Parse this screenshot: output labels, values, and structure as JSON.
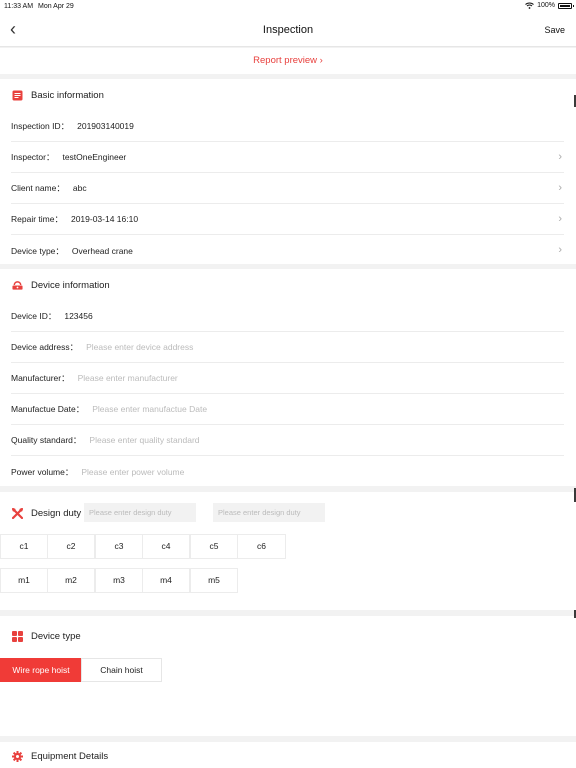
{
  "status": {
    "time": "11:33 AM",
    "date": "Mon Apr 29",
    "battery": "100%"
  },
  "nav": {
    "title": "Inspection",
    "save_label": "Save"
  },
  "report_preview": "Report preview ›",
  "basic": {
    "title": "Basic information",
    "rows": [
      {
        "label": "Inspection ID：",
        "value": "201903140019",
        "chevron": false
      },
      {
        "label": "Inspector：",
        "value": "testOneEngineer",
        "chevron": true
      },
      {
        "label": "Client name：",
        "value": "abc",
        "chevron": true
      },
      {
        "label": "Repair time：",
        "value": "2019-03-14 16:10",
        "chevron": true
      },
      {
        "label": "Device type：",
        "value": "Overhead crane",
        "chevron": true
      }
    ]
  },
  "device": {
    "title": "Device information",
    "rows": [
      {
        "label": "Device ID：",
        "value": "123456"
      },
      {
        "label": "Device address：",
        "placeholder": "Please enter device address"
      },
      {
        "label": "Manufacturer：",
        "placeholder": "Please enter manufacturer"
      },
      {
        "label": "Manufactue Date：",
        "placeholder": "Please enter manufactue Date"
      },
      {
        "label": "Quality standard：",
        "placeholder": "Please enter quality standard"
      },
      {
        "label": "Power volume：",
        "placeholder": "Please enter power volume"
      }
    ]
  },
  "duty": {
    "title": "Design duty",
    "placeholder_1": "Please enter design duty",
    "placeholder_2": "Please enter design duty",
    "c_options": [
      "c1",
      "c2",
      "c3",
      "c4",
      "c5",
      "c6"
    ],
    "m_options": [
      "m1",
      "m2",
      "m3",
      "m4",
      "m5"
    ]
  },
  "device_type": {
    "title": "Device type",
    "options": [
      {
        "label": "Wire rope hoist",
        "selected": true
      },
      {
        "label": "Chain hoist",
        "selected": false
      }
    ]
  },
  "equipment": {
    "title": "Equipment Details"
  },
  "colors": {
    "accent": "#e8413e",
    "selected": "#f03b37",
    "placeholder": "#bbbbbb"
  }
}
